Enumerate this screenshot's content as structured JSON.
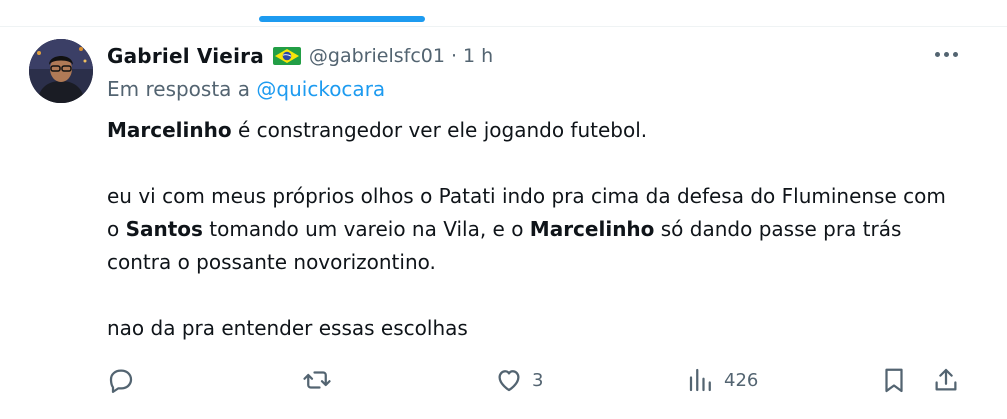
{
  "tweet": {
    "author_name": "Gabriel Vieira",
    "handle": "@gabrielsfc01",
    "separator": "·",
    "time": "1 h",
    "flag_icon": "brazil-flag-emoji",
    "reply_prefix": "Em resposta a",
    "reply_mention": "@quickocara",
    "paragraphs": [
      [
        {
          "text": "Marcelinho",
          "bold": true
        },
        {
          "text": " é constrangedor ver ele jogando futebol.",
          "bold": false
        }
      ],
      [
        {
          "text": "eu vi com meus próprios olhos o Patati indo pra cima da defesa do Fluminense com o ",
          "bold": false
        },
        {
          "text": "Santos",
          "bold": true
        },
        {
          "text": " tomando um vareio na Vila, e o ",
          "bold": false
        },
        {
          "text": "Marcelinho",
          "bold": true
        },
        {
          "text": " só dando passe pra trás contra o possante novorizontino.",
          "bold": false
        }
      ],
      [
        {
          "text": "nao da pra entender essas escolhas",
          "bold": false
        }
      ]
    ]
  },
  "actions": {
    "reply_icon": "reply-icon",
    "retweet_icon": "retweet-icon",
    "like_icon": "heart-icon",
    "like_count": "3",
    "views_icon": "views-icon",
    "views_count": "426",
    "bookmark_icon": "bookmark-icon",
    "share_icon": "share-icon"
  },
  "colors": {
    "accent": "#1d9bf0",
    "text": "#0f1419",
    "muted": "#536471"
  }
}
